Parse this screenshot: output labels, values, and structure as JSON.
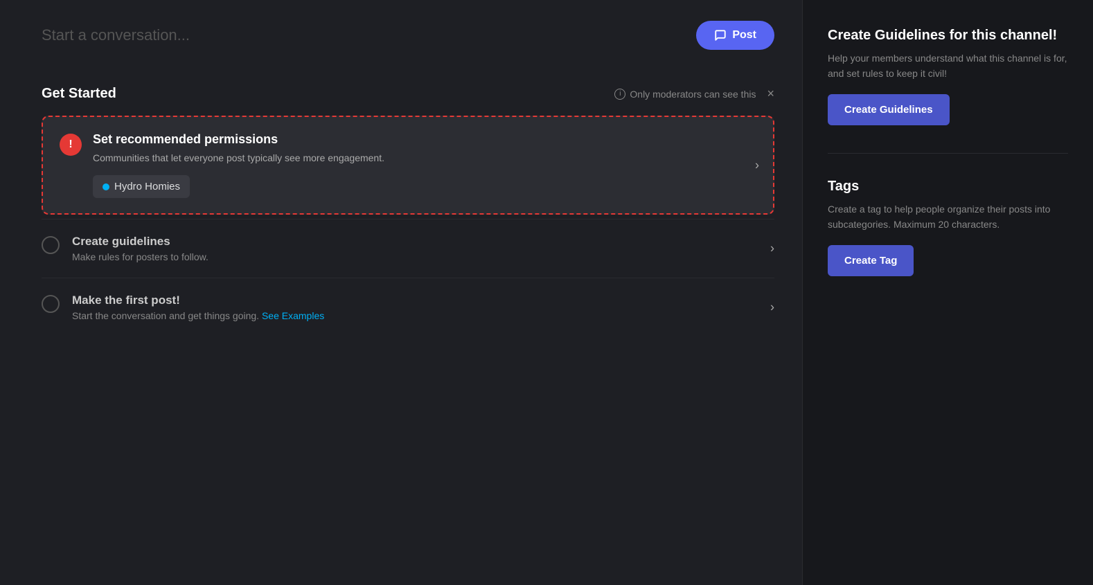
{
  "conversation": {
    "placeholder": "Start a conversation...",
    "post_button_label": "Post"
  },
  "get_started": {
    "title": "Get Started",
    "moderator_notice": "Only moderators can see this",
    "close_label": "×"
  },
  "permissions_card": {
    "title": "Set recommended permissions",
    "description": "Communities that let everyone post typically see more engagement.",
    "community_name": "Hydro Homies"
  },
  "checklist": [
    {
      "title": "Create guidelines",
      "description": "Make rules for posters to follow."
    },
    {
      "title": "Make the first post!",
      "description": "Start the conversation and get things going.",
      "link_text": "See Examples"
    }
  ],
  "right_panel": {
    "guidelines_section": {
      "title": "Create Guidelines for this channel!",
      "description": "Help your members understand what this channel is for, and set rules to keep it civil!",
      "button_label": "Create Guidelines"
    },
    "tags_section": {
      "title": "Tags",
      "description": "Create a tag to help people organize their posts into subcategories. Maximum 20 characters.",
      "button_label": "Create Tag"
    }
  },
  "icons": {
    "info": "ℹ",
    "alert": "!",
    "chevron_right": "›",
    "close": "×",
    "chat": "💬",
    "dot": "•"
  }
}
